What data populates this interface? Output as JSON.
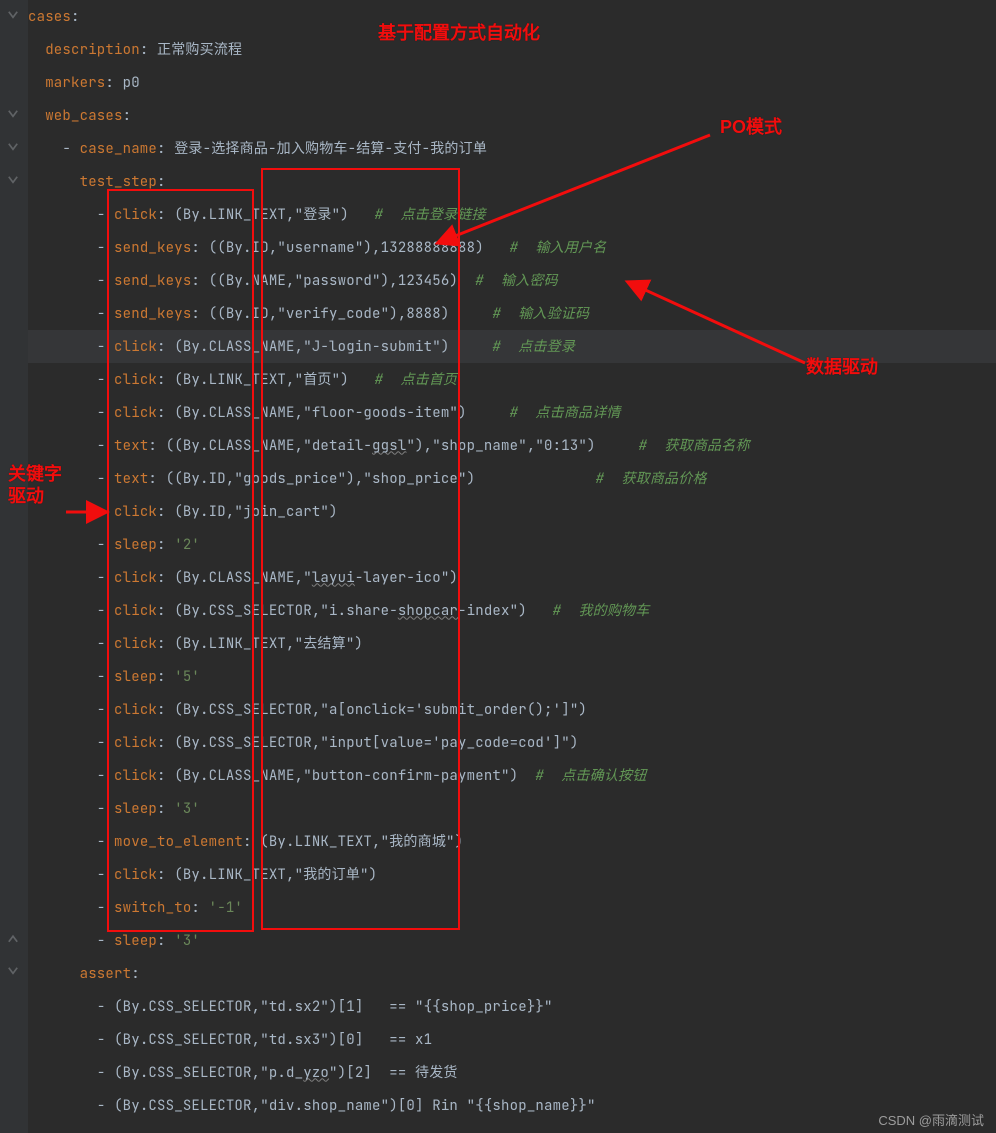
{
  "annotations": {
    "title_top": "基于配置方式自动化",
    "po_mode": "PO模式",
    "data_driven": "数据驱动",
    "keyword_driven_l1": "关键字",
    "keyword_driven_l2": "驱动"
  },
  "watermark": "CSDN @雨滴测试",
  "lines": [
    {
      "i": 0,
      "indent": 0,
      "key": "cases",
      "rest": ":"
    },
    {
      "i": 1,
      "indent": 1,
      "key": "description",
      "rest": ": ",
      "str": "正常购买流程"
    },
    {
      "i": 2,
      "indent": 1,
      "key": "markers",
      "rest": ": ",
      "str": "p0"
    },
    {
      "i": 3,
      "indent": 1,
      "key": "web_cases",
      "rest": ":"
    },
    {
      "i": 4,
      "indent": 2,
      "dash": true,
      "key": "case_name",
      "rest": ": ",
      "str": "登录-选择商品-加入购物车-结算-支付-我的订单"
    },
    {
      "i": 5,
      "indent": 3,
      "key": "test_step",
      "rest": ":"
    },
    {
      "i": 6,
      "indent": 4,
      "dash": true,
      "key": "click",
      "rest": ": ",
      "val": "(By.LINK_TEXT,\"登录\")",
      "pad": "   ",
      "comment": "#  点击登录链接"
    },
    {
      "i": 7,
      "indent": 4,
      "dash": true,
      "key": "send_keys",
      "rest": ": ",
      "val": "((By.ID,\"username\"),13288888888)",
      "pad": "   ",
      "comment": "#  输入用户名"
    },
    {
      "i": 8,
      "indent": 4,
      "dash": true,
      "key": "send_keys",
      "rest": ": ",
      "val": "((By.NAME,\"password\"),123456)",
      "pad": "  ",
      "comment": "#  输入密码"
    },
    {
      "i": 9,
      "indent": 4,
      "dash": true,
      "key": "send_keys",
      "rest": ": ",
      "val": "((By.ID,\"verify_code\"),8888)",
      "pad": "     ",
      "comment": "#  输入验证码"
    },
    {
      "i": 10,
      "indent": 4,
      "dash": true,
      "key": "click",
      "rest": ": ",
      "val": "(By.CLASS_NAME,\"J-login-submit\")",
      "pad": "     ",
      "comment": "#  点击登录",
      "hl": true
    },
    {
      "i": 11,
      "indent": 4,
      "dash": true,
      "key": "click",
      "rest": ": ",
      "val": "(By.LINK_TEXT,\"首页\")",
      "pad": "   ",
      "comment": "#  点击首页"
    },
    {
      "i": 12,
      "indent": 4,
      "dash": true,
      "key": "click",
      "rest": ": ",
      "val": "(By.CLASS_NAME,\"floor-goods-item\")",
      "pad": "     ",
      "comment": "#  点击商品详情"
    },
    {
      "i": 13,
      "indent": 4,
      "dash": true,
      "key": "text",
      "rest": ": ",
      "val": "((By.CLASS_NAME,\"detail-ggsl\"),\"shop_name\",\"0:13\")",
      "pad": "     ",
      "comment": "#  获取商品名称",
      "wave": [
        "ggsl"
      ]
    },
    {
      "i": 14,
      "indent": 4,
      "dash": true,
      "key": "text",
      "rest": ": ",
      "val": "((By.ID,\"goods_price\"),\"shop_price\")",
      "pad": "              ",
      "comment": "#  获取商品价格"
    },
    {
      "i": 15,
      "indent": 4,
      "dash": true,
      "key": "click",
      "rest": ": ",
      "val": "(By.ID,\"join_cart\")"
    },
    {
      "i": 16,
      "indent": 4,
      "dash": true,
      "key": "sleep",
      "rest": ": ",
      "sq": "'2'"
    },
    {
      "i": 17,
      "indent": 4,
      "dash": true,
      "key": "click",
      "rest": ": ",
      "val": "(By.CLASS_NAME,\"layui-layer-ico\")",
      "wave": [
        "layui"
      ]
    },
    {
      "i": 18,
      "indent": 4,
      "dash": true,
      "key": "click",
      "rest": ": ",
      "val": "(By.CSS_SELECTOR,\"i.share-shopcar-index\")",
      "pad": "   ",
      "comment": "#  我的购物车",
      "wave": [
        "shopcar"
      ]
    },
    {
      "i": 19,
      "indent": 4,
      "dash": true,
      "key": "click",
      "rest": ": ",
      "val": "(By.LINK_TEXT,\"去结算\")"
    },
    {
      "i": 20,
      "indent": 4,
      "dash": true,
      "key": "sleep",
      "rest": ": ",
      "sq": "'5'"
    },
    {
      "i": 21,
      "indent": 4,
      "dash": true,
      "key": "click",
      "rest": ": ",
      "val": "(By.CSS_SELECTOR,\"a[onclick='submit_order();']\")"
    },
    {
      "i": 22,
      "indent": 4,
      "dash": true,
      "key": "click",
      "rest": ": ",
      "val": "(By.CSS_SELECTOR,\"input[value='pay_code=cod']\")"
    },
    {
      "i": 23,
      "indent": 4,
      "dash": true,
      "key": "click",
      "rest": ": ",
      "val": "(By.CLASS_NAME,\"button-confirm-payment\")",
      "pad": "  ",
      "comment": "#  点击确认按钮"
    },
    {
      "i": 24,
      "indent": 4,
      "dash": true,
      "key": "sleep",
      "rest": ": ",
      "sq": "'3'"
    },
    {
      "i": 25,
      "indent": 4,
      "dash": true,
      "key": "move_to_element",
      "rest": ": ",
      "val": "(By.LINK_TEXT,\"我的商城\")"
    },
    {
      "i": 26,
      "indent": 4,
      "dash": true,
      "key": "click",
      "rest": ": ",
      "val": "(By.LINK_TEXT,\"我的订单\")"
    },
    {
      "i": 27,
      "indent": 4,
      "dash": true,
      "key": "switch_to",
      "rest": ": ",
      "sq": "'-1'"
    },
    {
      "i": 28,
      "indent": 4,
      "dash": true,
      "key": "sleep",
      "rest": ": ",
      "sq": "'3'"
    },
    {
      "i": 29,
      "indent": 3,
      "key": "assert",
      "rest": ":"
    },
    {
      "i": 30,
      "indent": 4,
      "dash": true,
      "val": "(By.CSS_SELECTOR,\"td.sx2\")[1]   == \"{{shop_price}}\""
    },
    {
      "i": 31,
      "indent": 4,
      "dash": true,
      "val": "(By.CSS_SELECTOR,\"td.sx3\")[0]   == x1"
    },
    {
      "i": 32,
      "indent": 4,
      "dash": true,
      "val": "(By.CSS_SELECTOR,\"p.d_yzo\")[2]  == 待发货",
      "wave": [
        "yzo"
      ]
    },
    {
      "i": 33,
      "indent": 4,
      "dash": true,
      "val": "(By.CSS_SELECTOR,\"div.shop_name\")[0] Rin \"{{shop_name}}\""
    }
  ]
}
